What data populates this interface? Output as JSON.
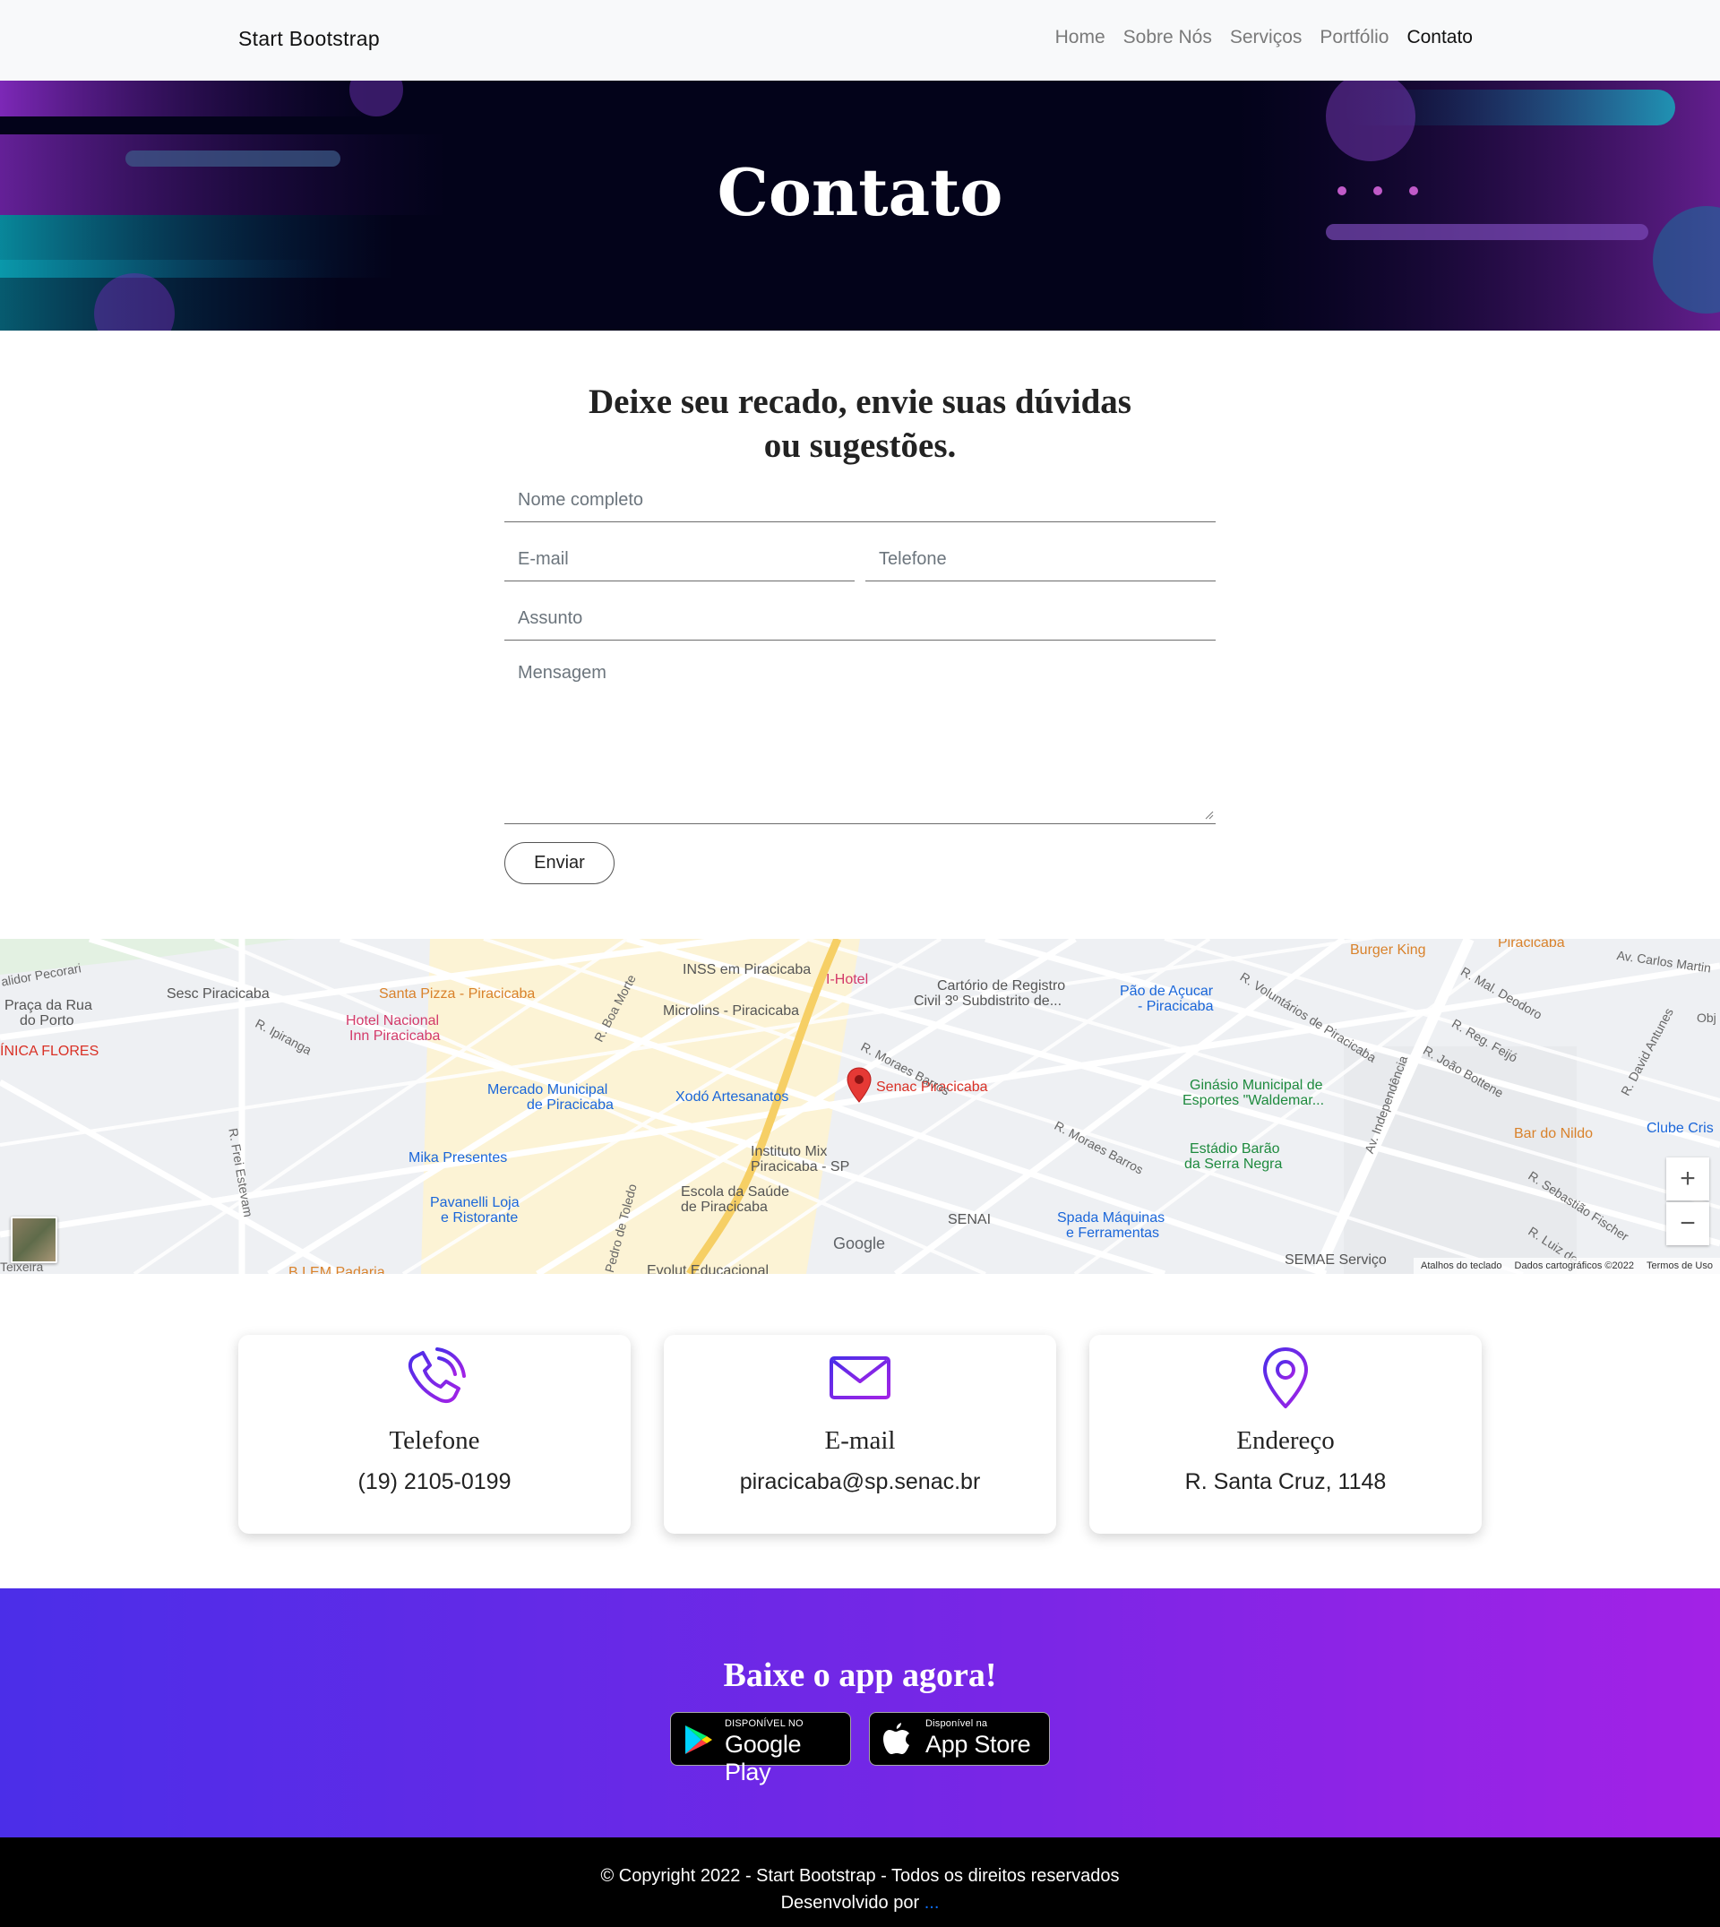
{
  "navbar": {
    "brand": "Start Bootstrap",
    "items": [
      {
        "label": "Home",
        "active": false
      },
      {
        "label": "Sobre Nós",
        "active": false
      },
      {
        "label": "Serviços",
        "active": false
      },
      {
        "label": "Portfólio",
        "active": false
      },
      {
        "label": "Contato",
        "active": true
      }
    ]
  },
  "hero": {
    "title": "Contato"
  },
  "form": {
    "heading_line1": "Deixe seu recado, envie suas dúvidas",
    "heading_line2": "ou sugestões.",
    "name_placeholder": "Nome completo",
    "email_placeholder": "E-mail",
    "phone_placeholder": "Telefone",
    "subject_placeholder": "Assunto",
    "message_placeholder": "Mensagem",
    "submit_label": "Enviar"
  },
  "map": {
    "pin_label": "Senac Piracicaba",
    "places": [
      {
        "name": "INSS em Piracicaba",
        "color": "grey"
      },
      {
        "name": "Sesc Piracicaba",
        "color": "grey"
      },
      {
        "name": "Santa Pizza - Piracicaba",
        "color": "orange"
      },
      {
        "name": "Hotel Nacional",
        "color": "pink"
      },
      {
        "name": "Inn Piracicaba",
        "color": "pink"
      },
      {
        "name": "Microlins - Piracicaba",
        "color": "grey"
      },
      {
        "name": "I-Hotel",
        "color": "pink"
      },
      {
        "name": "Cartório de Registro",
        "color": "grey"
      },
      {
        "name": "Civil 3º Subdistrito de...",
        "color": "grey"
      },
      {
        "name": "Pão de Açucar",
        "color": "blue"
      },
      {
        "name": "- Piracicaba",
        "color": "blue"
      },
      {
        "name": "Burger King",
        "color": "orange"
      },
      {
        "name": "Mercado Municipal",
        "color": "blue"
      },
      {
        "name": "de Piracicaba",
        "color": "blue"
      },
      {
        "name": "Xodó Artesanatos",
        "color": "blue"
      },
      {
        "name": "Ginásio Municipal de",
        "color": "green"
      },
      {
        "name": "Esportes \"Waldemar...",
        "color": "green"
      },
      {
        "name": "Mika Presentes",
        "color": "blue"
      },
      {
        "name": "Instituto Mix",
        "color": "grey"
      },
      {
        "name": "Piracicaba - SP",
        "color": "grey"
      },
      {
        "name": "Estádio Barão",
        "color": "green"
      },
      {
        "name": "da Serra Negra",
        "color": "green"
      },
      {
        "name": "Bar do Nildo",
        "color": "orange"
      },
      {
        "name": "Clube Cris",
        "color": "blue"
      },
      {
        "name": "Pavanelli Loja",
        "color": "blue"
      },
      {
        "name": "e Ristorante",
        "color": "blue"
      },
      {
        "name": "Escola da Saúde",
        "color": "grey"
      },
      {
        "name": "de Piracicaba",
        "color": "grey"
      },
      {
        "name": "SENAI",
        "color": "grey"
      },
      {
        "name": "Spada Máquinas",
        "color": "blue"
      },
      {
        "name": "e Ferramentas",
        "color": "blue"
      },
      {
        "name": "Praça da Rua",
        "color": "grey"
      },
      {
        "name": "do Porto",
        "color": "grey"
      },
      {
        "name": "ÍNICA FLORES",
        "color": "red"
      },
      {
        "name": "SEMAE Serviço",
        "color": "grey"
      },
      {
        "name": "Evolut Educacional",
        "color": "grey"
      },
      {
        "name": "B LEM Padaria",
        "color": "orange"
      },
      {
        "name": "Piracicaba",
        "color": "orange"
      }
    ],
    "streets": [
      "R. Moraes Barros",
      "R. Moraes Barros",
      "R. Boa Morte",
      "R. Ipiranga",
      "R. Frei Estevam",
      "Pedro de Toledo",
      "Av. Independência",
      "R. Voluntários de Piracicaba",
      "R. Mal. Deodoro",
      "R. Reg. Feijó",
      "R. João Bottene",
      "R. David Antunes",
      "R. Sebastião Fischer",
      "R. Luiz de",
      "Av. Carlos Martin",
      "alidor Pecorari",
      "Teixeira",
      "Obj"
    ],
    "google_logo": "Google",
    "zoom_in": "+",
    "zoom_out": "−",
    "footer_shortcuts": "Atalhos do teclado",
    "footer_data": "Dados cartográficos ©2022",
    "footer_terms": "Termos de Uso"
  },
  "contacts": [
    {
      "title": "Telefone",
      "value": "(19) 2105-0199",
      "icon": "phone-icon"
    },
    {
      "title": "E-mail",
      "value": "piracicaba@sp.senac.br",
      "icon": "envelope-icon"
    },
    {
      "title": "Endereço",
      "value": "R. Santa Cruz, 1148",
      "icon": "location-pin-icon"
    }
  ],
  "app": {
    "title": "Baixe o app agora!",
    "google_play_small": "DISPONÍVEL NO",
    "google_play_big": "Google Play",
    "app_store_small": "Disponível na",
    "app_store_big": "App Store"
  },
  "footer": {
    "copyright": "© Copyright 2022 - Start Bootstrap - Todos os direitos reservados",
    "developed_by": "Desenvolvido por",
    "developer_link": "..."
  },
  "colors": {
    "accent_purple": "#7b2ff2",
    "gradient_start": "#4b2ee8",
    "gradient_end": "#a322e6",
    "link_blue": "#0d6efd"
  }
}
